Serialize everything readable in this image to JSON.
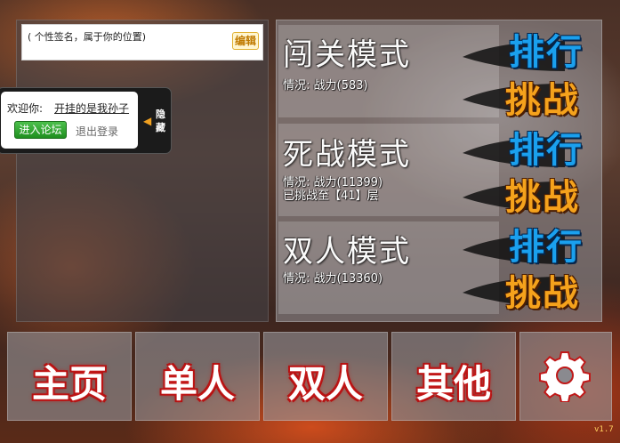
{
  "profile": {
    "signature_placeholder": "( 个性签名，属于你的位置)",
    "edit_label": "编辑"
  },
  "welcome": {
    "label": "欢迎你:",
    "username": "开挂的是我孙子",
    "forum_button": "进入论坛",
    "logout_link": "退出登录",
    "hide_label": "隐藏"
  },
  "modes": [
    {
      "title": "闯关模式",
      "status": "情况: 战力(583)",
      "extra": "",
      "rank_label": "排行",
      "challenge_label": "挑战"
    },
    {
      "title": "死战模式",
      "status": "情况: 战力(11399)",
      "extra": "已挑战至【41】层",
      "rank_label": "排行",
      "challenge_label": "挑战"
    },
    {
      "title": "双人模式",
      "status": "情况: 战力(13360)",
      "extra": "",
      "rank_label": "排行",
      "challenge_label": "挑战"
    }
  ],
  "nav": {
    "home": "主页",
    "single": "单人",
    "double": "双人",
    "other": "其他",
    "settings_icon": "gear-icon"
  },
  "version": "v1.7",
  "colors": {
    "rank": "#1aa0ee",
    "challenge": "#f5a21c",
    "nav_text_glow": "#d02020",
    "forum_button": "#2aa02a"
  }
}
